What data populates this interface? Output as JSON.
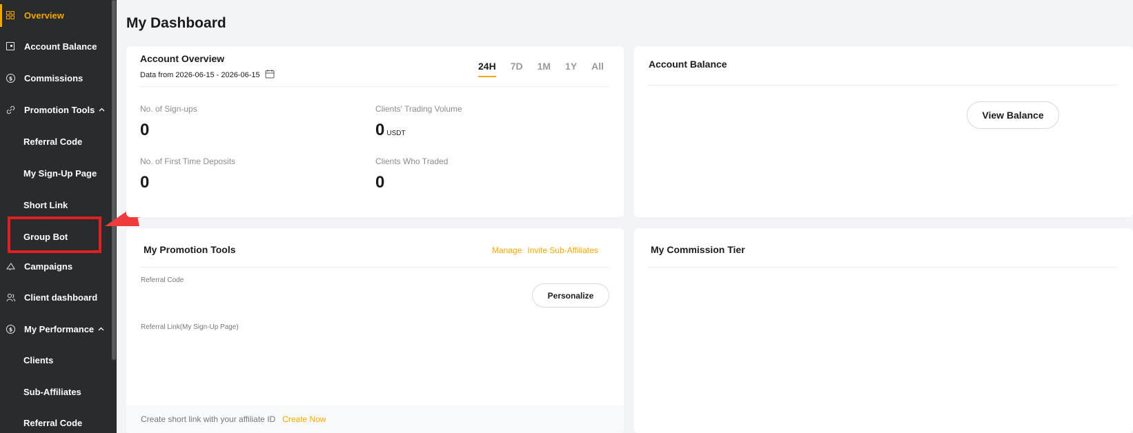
{
  "sidebar": {
    "items": [
      {
        "label": "Overview",
        "icon": "grid-icon"
      },
      {
        "label": "Account Balance",
        "icon": "wallet-icon"
      },
      {
        "label": "Commissions",
        "icon": "dollar-circle-icon"
      },
      {
        "label": "Promotion Tools",
        "icon": "link-icon"
      },
      {
        "label": "Campaigns",
        "icon": "megaphone-icon"
      },
      {
        "label": "Client dashboard",
        "icon": "users-icon"
      },
      {
        "label": "My Performance",
        "icon": "dollar-circle-icon"
      }
    ],
    "promotion_sub": [
      "Referral Code",
      "My Sign-Up Page",
      "Short Link",
      "Group Bot"
    ],
    "performance_sub": [
      "Clients",
      "Sub-Affiliates",
      "Referral Code"
    ],
    "accent_color": "#f7a600"
  },
  "page": {
    "title": "My Dashboard"
  },
  "account_overview": {
    "title": "Account Overview",
    "date_range": "Data from 2026-06-15 - 2026-06-15",
    "tabs": [
      "24H",
      "7D",
      "1M",
      "1Y",
      "All"
    ],
    "active_tab": "24H",
    "stats": {
      "signups_label": "No. of Sign-ups",
      "signups_value": "0",
      "volume_label": "Clients' Trading Volume",
      "volume_value": "0",
      "volume_unit": "USDT",
      "ftd_label": "No. of First Time Deposits",
      "ftd_value": "0",
      "traded_label": "Clients Who Traded",
      "traded_value": "0"
    }
  },
  "account_balance": {
    "title": "Account Balance",
    "view_button": "View Balance"
  },
  "promotion_tools": {
    "title": "My Promotion Tools",
    "manage": "Manage",
    "invite": "Invite Sub-Affiliates",
    "referral_code_label": "Referral Code",
    "personalize_button": "Personalize",
    "referral_link_label": "Referral Link(My Sign-Up Page)",
    "footer_text": "Create short link with your affiliate ID",
    "footer_link": "Create Now"
  },
  "commission_tier": {
    "title": "My Commission Tier"
  }
}
